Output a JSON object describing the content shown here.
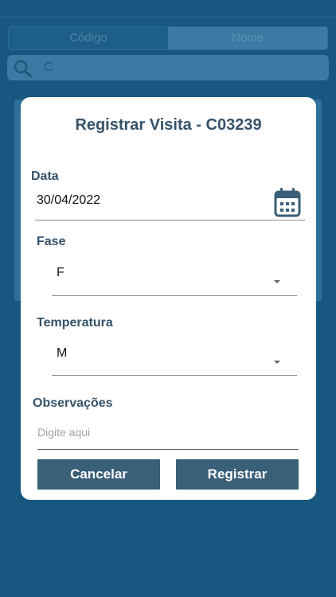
{
  "tabs": {
    "codigo": "Código",
    "nome": "Nome"
  },
  "search": {
    "value": "C",
    "icon": "search-icon"
  },
  "modal": {
    "title": "Registrar Visita - C03239",
    "data_label": "Data",
    "data_value": "30/04/2022",
    "calendar_icon": "calendar-icon",
    "fase_label": "Fase",
    "fase_value": "F",
    "temperatura_label": "Temperatura",
    "temperatura_value": "M",
    "observacoes_label": "Observações",
    "observacoes_placeholder": "Digite aqui",
    "cancel_label": "Cancelar",
    "register_label": "Registrar"
  },
  "colors": {
    "background": "#18577f",
    "title_text": "#37536a",
    "button_bg": "#3a5f78"
  }
}
